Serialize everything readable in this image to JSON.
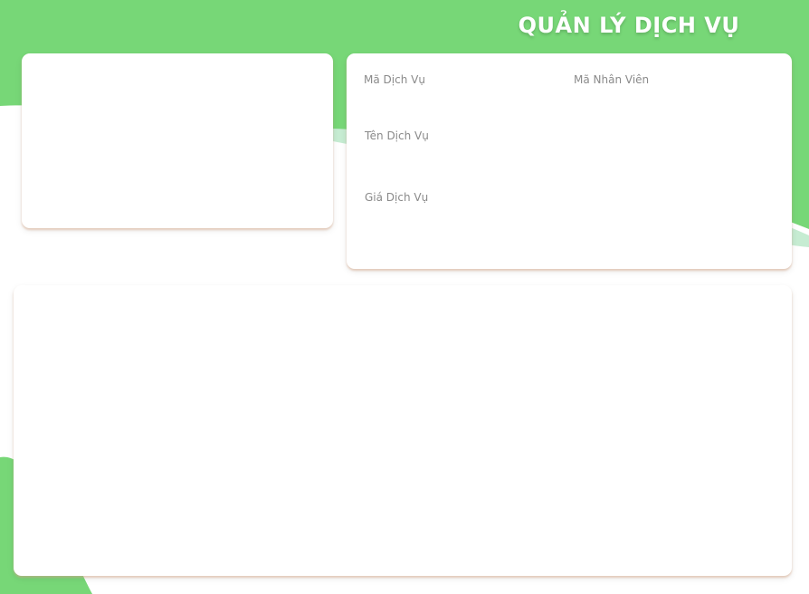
{
  "header": {
    "title": "QUẢN LÝ DỊCH VỤ"
  },
  "form": {
    "ma_dich_vu": {
      "label": "Mã Dịch Vụ",
      "value": ""
    },
    "ma_nhan_vien": {
      "label": "Mã Nhân Viên",
      "value": ""
    },
    "ten_dich_vu": {
      "label": "Tên Dịch Vụ",
      "value": ""
    },
    "gia_dich_vu": {
      "label": "Giá Dịch Vụ",
      "value": ""
    }
  },
  "colors": {
    "background_green": "#77d777",
    "accent_light_green": "#c6ecd2",
    "card_shadow": "#d6aa8c"
  }
}
